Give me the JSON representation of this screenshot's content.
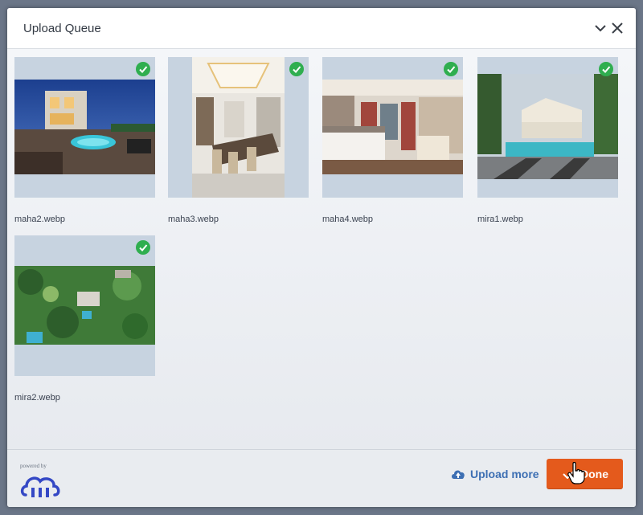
{
  "dialog": {
    "title": "Upload Queue"
  },
  "files": [
    {
      "name": "maha2.webp",
      "status": "uploaded"
    },
    {
      "name": "maha3.webp",
      "status": "uploaded"
    },
    {
      "name": "maha4.webp",
      "status": "uploaded"
    },
    {
      "name": "mira1.webp",
      "status": "uploaded"
    },
    {
      "name": "mira2.webp",
      "status": "uploaded"
    }
  ],
  "footer": {
    "powered_by": "powered by",
    "upload_more_label": "Upload more",
    "done_label": "Done"
  },
  "colors": {
    "accent": "#e45a1c",
    "link": "#3d6fb3",
    "success": "#2fae4f",
    "tile_bg": "#c7d3e0"
  },
  "icons": [
    "chevron-down-icon",
    "close-icon",
    "check-circle-icon",
    "cloud-upload-icon",
    "checkmark-icon",
    "cloudinary-logo"
  ]
}
